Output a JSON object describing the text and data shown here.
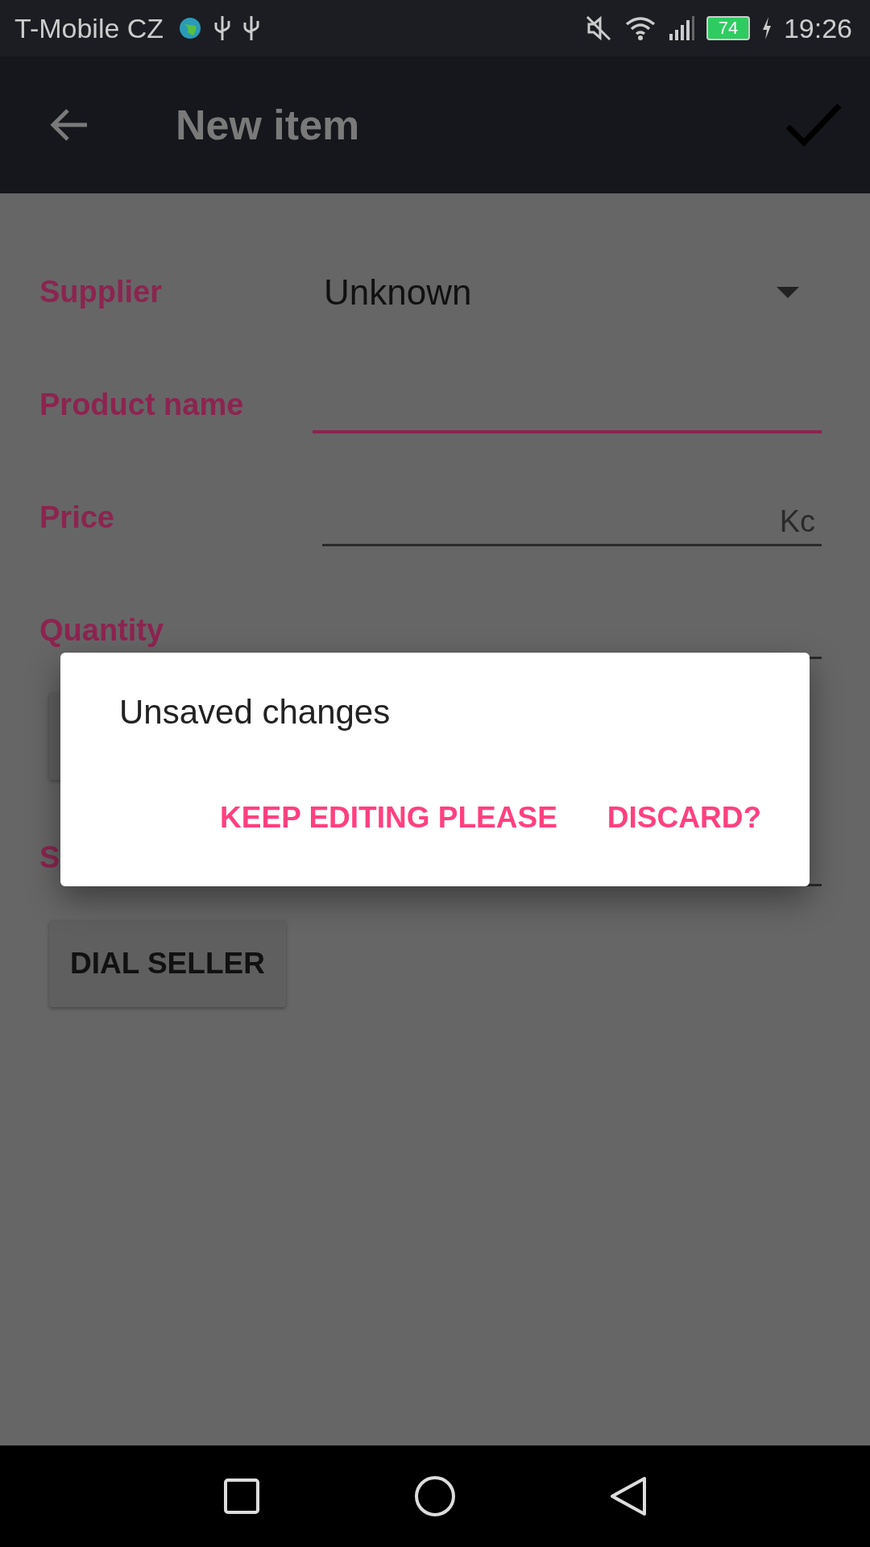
{
  "status_bar": {
    "carrier": "T-Mobile CZ",
    "battery": "74",
    "time": "19:26"
  },
  "app_bar": {
    "title": "New item"
  },
  "fields": [
    {
      "kind": "dropdown",
      "label": "Supplier",
      "value": "Unknown"
    },
    {
      "kind": "text",
      "label": "Product name",
      "focused": true
    },
    {
      "kind": "text",
      "label": "Price",
      "suffix": "Kc",
      "focused": false
    },
    {
      "kind": "text",
      "label": "Quantity",
      "focused": false
    },
    {
      "kind": "button"
    },
    {
      "kind": "text",
      "label": "S",
      "focused": false
    },
    {
      "kind": "button",
      "label": "DIAL SELLER"
    }
  ],
  "dialog": {
    "title": "Unsaved changes",
    "buttons": [
      "KEEP EDITING PLEASE",
      "DISCARD?"
    ]
  }
}
